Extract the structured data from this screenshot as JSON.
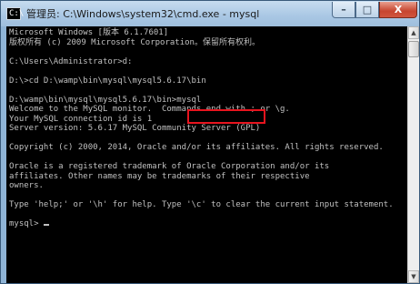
{
  "window": {
    "icon_text": "C:\\",
    "title": "管理员: C:\\Windows\\system32\\cmd.exe - mysql",
    "controls": {
      "minimize": "–",
      "maximize": "□",
      "close": "X"
    }
  },
  "console": {
    "lines": [
      "Microsoft Windows [版本 6.1.7601]",
      "版权所有 (c) 2009 Microsoft Corporation。保留所有权利。",
      "",
      "C:\\Users\\Administrator>d:",
      "",
      "D:\\>cd D:\\wamp\\bin\\mysql\\mysql5.6.17\\bin",
      "",
      "D:\\wamp\\bin\\mysql\\mysql5.6.17\\bin>mysql",
      "Welcome to the MySQL monitor.  Commands end with ; or \\g.",
      "Your MySQL connection id is 1",
      "Server version: 5.6.17 MySQL Community Server (GPL)",
      "",
      "Copyright (c) 2000, 2014, Oracle and/or its affiliates. All rights reserved.",
      "",
      "Oracle is a registered trademark of Oracle Corporation and/or its",
      "affiliates. Other names may be trademarks of their respective",
      "owners.",
      "",
      "Type 'help;' or '\\h' for help. Type '\\c' to clear the current input statement.",
      "",
      "mysql> "
    ]
  },
  "scrollbar": {
    "up_arrow": "▲",
    "down_arrow": "▼"
  }
}
